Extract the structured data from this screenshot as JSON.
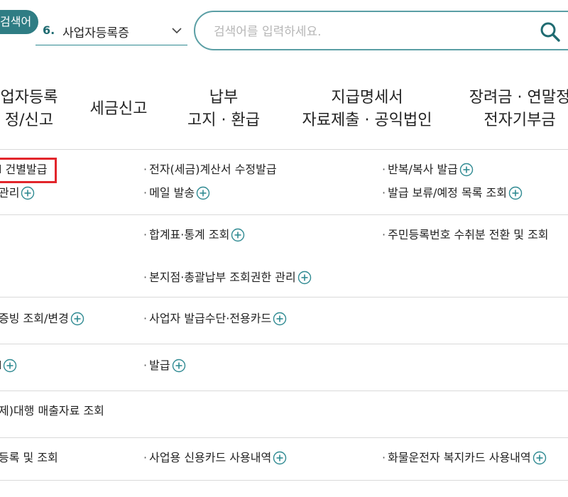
{
  "search": {
    "tag_label": "검색어",
    "category_number": "6.",
    "category_label": "사업자등록증",
    "placeholder": "검색어를 입력하세요."
  },
  "menu_headers": [
    {
      "line1": "업자등록",
      "line2": "정/신고"
    },
    {
      "line1": "세금신고",
      "line2": ""
    },
    {
      "line1": "납부",
      "line2": "고지 · 환급"
    },
    {
      "line1": "지급명세서",
      "line2": "자료제출 · 공익법인"
    },
    {
      "line1": "장려금 · 연말정",
      "line2": "전자기부금"
    }
  ],
  "rows": [
    {
      "items": [
        {
          "label": "l 건별발급",
          "plus": false
        },
        {
          "label": "전자(세금)계산서 수정발급",
          "plus": false
        },
        {
          "label": "반복/복사 발급",
          "plus": true
        },
        {
          "label": "관리",
          "plus": true
        },
        {
          "label": "메일 발송",
          "plus": true
        },
        {
          "label": "발급 보류/예정 목록 조회",
          "plus": true
        }
      ]
    },
    {
      "items": [
        {
          "label": "합계표·통계 조회",
          "plus": true
        },
        {
          "label": "주민등록번호 수취분 전환 및 조회",
          "plus": false
        },
        {
          "label": "본지점·총괄납부 조회권한 관리",
          "plus": true
        }
      ]
    },
    {
      "items": [
        {
          "label": "증빙 조회/변경",
          "plus": true
        },
        {
          "label": "사업자 발급수단·전용카드",
          "plus": true
        }
      ]
    },
    {
      "items": [
        {
          "label": "l",
          "plus": true
        },
        {
          "label": "발급",
          "plus": true
        }
      ]
    },
    {
      "items": [
        {
          "label": "제)대행 매출자료 조회",
          "plus": false
        }
      ]
    },
    {
      "items": [
        {
          "label": "등록 및 조회",
          "plus": false
        },
        {
          "label": "사업용 신용카드 사용내역",
          "plus": true
        },
        {
          "label": "화물운전자 복지카드 사용내역",
          "plus": true
        }
      ]
    }
  ]
}
